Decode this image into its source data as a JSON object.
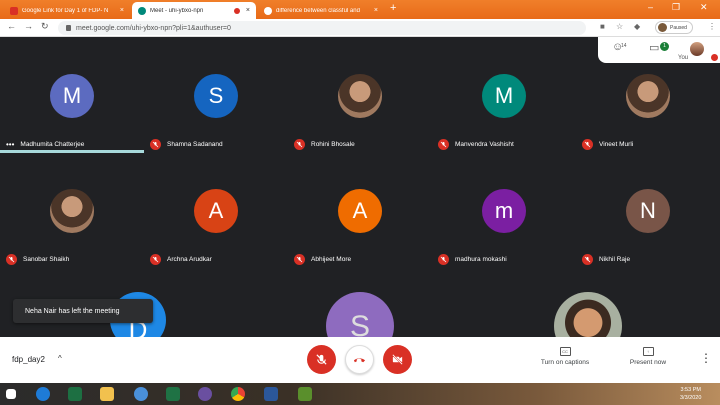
{
  "browser": {
    "tabs": [
      {
        "title": "Google Link for Day 1 of FDP- N",
        "favicon_color": "#d93025",
        "active": false
      },
      {
        "title": "Meet - uhi-ybxo-npn",
        "favicon_color": "#00897b",
        "active": true
      },
      {
        "title": "difference between classful and",
        "favicon_color": "#4285f4",
        "active": false
      }
    ],
    "close_glyph": "×",
    "new_tab_glyph": "+",
    "url": "meet.google.com/uhi-ybxo-npn?pli=1&authuser=0",
    "profile_status": "Paused"
  },
  "meet_header": {
    "people_count": "14",
    "chat_badge": "1",
    "you_label": "You"
  },
  "participants": [
    {
      "name": "Madhumita Chatterjee",
      "initial": "M",
      "color": "#5c6bc0",
      "speaking": true,
      "muted": false,
      "photo": false
    },
    {
      "name": "Shamna Sadanand",
      "initial": "S",
      "color": "#1565c0",
      "speaking": false,
      "muted": true,
      "photo": false
    },
    {
      "name": "Rohini Bhosale",
      "initial": "",
      "color": "",
      "speaking": false,
      "muted": true,
      "photo": true
    },
    {
      "name": "Manvendra Vashisht",
      "initial": "M",
      "color": "#00897b",
      "speaking": false,
      "muted": true,
      "photo": false
    },
    {
      "name": "Vineet Murli",
      "initial": "",
      "color": "",
      "speaking": false,
      "muted": true,
      "photo": true
    },
    {
      "name": "Sanobar Shaikh",
      "initial": "",
      "color": "",
      "speaking": false,
      "muted": true,
      "photo": true
    },
    {
      "name": "Archna Arudkar",
      "initial": "A",
      "color": "#d84315",
      "speaking": false,
      "muted": true,
      "photo": false
    },
    {
      "name": "Abhijeet More",
      "initial": "A",
      "color": "#ef6c00",
      "speaking": false,
      "muted": true,
      "photo": false
    },
    {
      "name": "madhura mokashi",
      "initial": "m",
      "color": "#7b1fa2",
      "speaking": false,
      "muted": true,
      "photo": false
    },
    {
      "name": "Nikhil Raje",
      "initial": "N",
      "color": "#795548",
      "speaking": false,
      "muted": true,
      "photo": false
    }
  ],
  "partial_tiles": [
    {
      "initial": "D",
      "color": "#1e88e5"
    },
    {
      "initial": "S",
      "color": "#8e6bbf"
    },
    {
      "initial": "",
      "color": "#6d4c41"
    }
  ],
  "toast": "Neha Nair has left the meeting",
  "bottom_bar": {
    "meeting_name": "fdp_day2",
    "caret_glyph": "^",
    "captions_label": "Turn on captions",
    "captions_icon_text": "CC",
    "present_label": "Present now",
    "more_glyph": "⋮"
  },
  "taskbar": {
    "time": "3:53 PM",
    "date": "3/3/2020"
  },
  "colors": {
    "accent_red": "#d93025",
    "chrome_orange": "#e86a18",
    "meet_bg": "#202124"
  }
}
